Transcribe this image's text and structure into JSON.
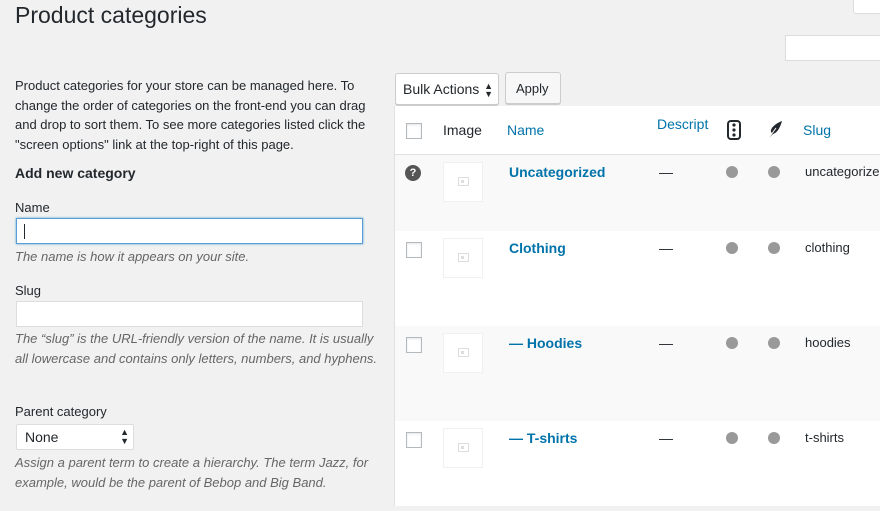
{
  "page": {
    "title": "Product categories"
  },
  "intro": "Product categories for your store can be managed here. To change the order of categories on the front-end you can drag and drop to sort them. To see more categories listed click the \"screen options\" link at the top-right of this page.",
  "form": {
    "heading": "Add new category",
    "name_label": "Name",
    "name_value": "",
    "name_help": "The name is how it appears on your site.",
    "slug_label": "Slug",
    "slug_value": "",
    "slug_help": "The “slug” is the URL-friendly version of the name. It is usually all lowercase and contains only letters, numbers, and hyphens.",
    "parent_label": "Parent category",
    "parent_value": "None",
    "parent_help": "Assign a parent term to create a hierarchy. The term Jazz, for example, would be the parent of Bebop and Big Band."
  },
  "toolbar": {
    "bulk_label": "Bulk Actions",
    "apply_label": "Apply"
  },
  "columns": {
    "image": "Image",
    "name": "Name",
    "description": "Descript",
    "slug": "Slug"
  },
  "icons": {
    "featured": "traffic-light-icon",
    "seo": "feather-icon",
    "help": "question-circle-icon",
    "arrows": "select-arrows-icon"
  },
  "rows": [
    {
      "name": "Uncategorized",
      "desc": "—",
      "slug": "uncategorize"
    },
    {
      "name": "Clothing",
      "desc": "—",
      "slug": "clothing"
    },
    {
      "name": "— Hoodies",
      "desc": "—",
      "slug": "hoodies"
    },
    {
      "name": "— T-shirts",
      "desc": "—",
      "slug": "t-shirts"
    }
  ]
}
